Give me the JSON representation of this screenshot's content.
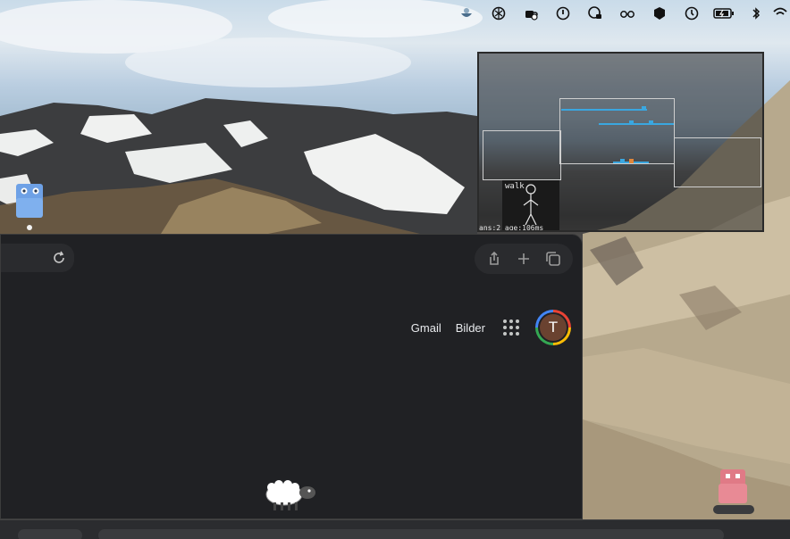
{
  "menubar": {
    "icons": [
      "bowl-icon",
      "openai-icon",
      "coffee-cup-icon",
      "power-icon",
      "lock-shield-icon",
      "glasses-icon",
      "cube-icon",
      "history-icon",
      "battery-charging-icon",
      "bluetooth-icon",
      "wifi-icon"
    ]
  },
  "overlay": {
    "walk_label": "walk",
    "stats": "ans:2 age:106ms"
  },
  "browser": {
    "links": {
      "gmail": "Gmail",
      "images": "Bilder"
    },
    "avatar_letter": "T",
    "avatar_colors": [
      "#ea4335",
      "#fbbc05",
      "#34a853",
      "#4285f4"
    ]
  },
  "colors": {
    "browser_bg": "#202124",
    "accent_blue": "#3aa7e0",
    "pet_blue": "#6ea1e6",
    "pet_pink": "#e07a86"
  }
}
